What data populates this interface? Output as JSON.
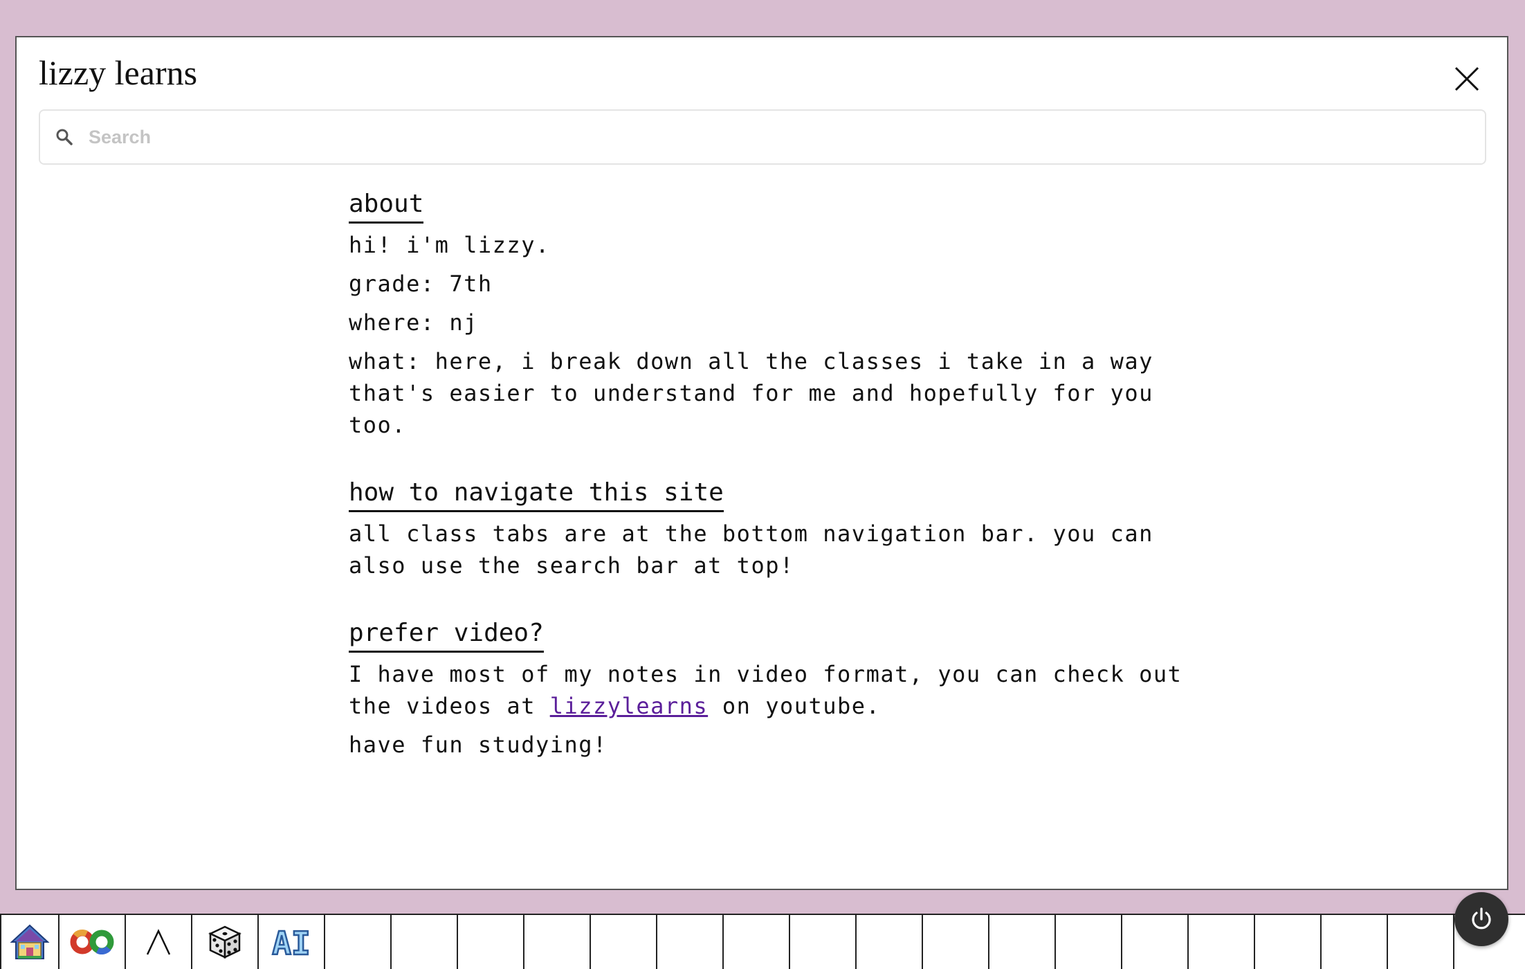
{
  "window": {
    "title": "lizzy learns",
    "search_placeholder": "Search"
  },
  "sections": {
    "about": {
      "heading": "about",
      "lines": [
        "hi! i'm lizzy.",
        "grade: 7th",
        "where: nj",
        "what: here, i break down all the classes i take in a way that's easier to understand for me and hopefully for you too."
      ]
    },
    "navigate": {
      "heading": "how to navigate this site",
      "text": "all class tabs are at the bottom navigation bar. you can also use the search bar at top!"
    },
    "video": {
      "heading": "prefer video?",
      "text_before": "I have most of my notes in video format, you can check out the videos at ",
      "link_text": "lizzylearns",
      "text_after": " on youtube.",
      "closing": "have fun studying!"
    }
  },
  "taskbar": {
    "icons": [
      "house-icon",
      "infinity-loop-icon",
      "caret-up-icon",
      "dice-icon",
      "ai-text-icon"
    ],
    "ai_label": "AI",
    "empty_slots": 17
  },
  "colors": {
    "background": "#d8bdd0",
    "link": "#5b1f9a",
    "power_button": "#2f2f2f"
  }
}
